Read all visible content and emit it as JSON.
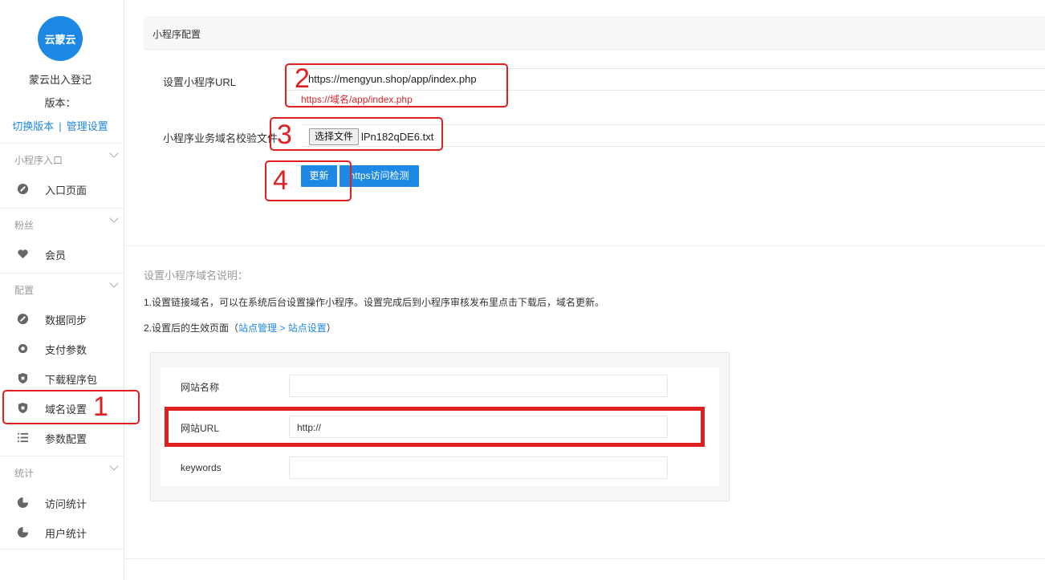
{
  "sidebar": {
    "logo_text": "云蒙云",
    "app_name": "蒙云出入登记",
    "version_label": "版本：",
    "link_switch": "切换版本",
    "link_sep": "|",
    "link_manage": "管理设置",
    "groups": [
      {
        "title": "小程序入口",
        "items": [
          {
            "label": "入口页面",
            "icon": "link-icon"
          }
        ]
      },
      {
        "title": "粉丝",
        "items": [
          {
            "label": "会员",
            "icon": "heart-icon"
          }
        ]
      },
      {
        "title": "配置",
        "items": [
          {
            "label": "数据同步",
            "icon": "link-icon"
          },
          {
            "label": "支付参数",
            "icon": "gear-icon"
          },
          {
            "label": "下载程序包",
            "icon": "shield-icon"
          },
          {
            "label": "域名设置",
            "icon": "shield-icon"
          },
          {
            "label": "参数配置",
            "icon": "list-icon"
          }
        ]
      },
      {
        "title": "统计",
        "items": [
          {
            "label": "访问统计",
            "icon": "pie-icon"
          },
          {
            "label": "用户统计",
            "icon": "pie-icon"
          }
        ]
      }
    ]
  },
  "panel": {
    "title": "小程序配置",
    "url_label": "设置小程序URL",
    "url_value": "https://mengyun.shop/app/index.php",
    "url_hint": "https://域名/app/index.php",
    "file_label": "小程序业务域名校验文件",
    "file_button": "选择文件",
    "file_name": "lPn182qDE6.txt",
    "update_button": "更新",
    "https_button": "https访问检测"
  },
  "annotations": {
    "n1": "1",
    "n2": "2",
    "n3": "3",
    "n4": "4"
  },
  "description": {
    "title": "设置小程序域名说明：",
    "line1": "1.设置链接域名，可以在系统后台设置操作小程序。设置完成后到小程序审核发布里点击下载后，域名更新。",
    "line2_prefix": "2.设置后的生效页面（",
    "line2_link1": "站点管理",
    "line2_arrow": ">",
    "line2_link2": "站点设置",
    "line2_suffix": "）"
  },
  "demo_form": {
    "site_name_label": "网站名称",
    "site_url_label": "网站URL",
    "site_url_value": "http://",
    "keywords_label": "keywords"
  },
  "colors": {
    "accent": "#1e88e5",
    "annotation": "#e02020"
  }
}
